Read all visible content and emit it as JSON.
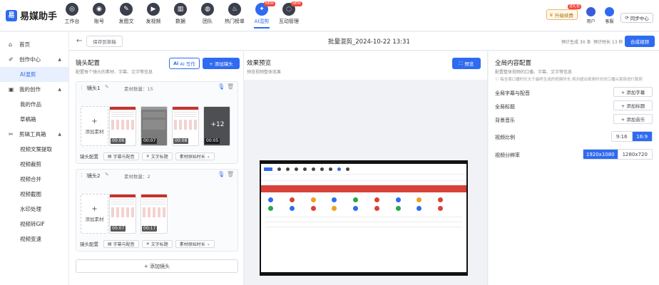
{
  "app": {
    "logo_letter": "易",
    "name": "易媒助手"
  },
  "nav": [
    {
      "label": "工作台",
      "icon": "workbench-icon",
      "glyph": "◎",
      "new": false
    },
    {
      "label": "账号",
      "icon": "account-icon",
      "glyph": "◉",
      "new": false
    },
    {
      "label": "发图文",
      "icon": "post-article-icon",
      "glyph": "✎",
      "new": false
    },
    {
      "label": "发视频",
      "icon": "post-video-icon",
      "glyph": "▶",
      "new": false
    },
    {
      "label": "数据",
      "icon": "data-icon",
      "glyph": "▥",
      "new": false
    },
    {
      "label": "团队",
      "icon": "team-icon",
      "glyph": "◍",
      "new": false
    },
    {
      "label": "热门榜单",
      "icon": "hot-list-icon",
      "glyph": "♨",
      "new": false
    },
    {
      "label": "AI混剪",
      "icon": "ai-mix-icon",
      "glyph": "✦",
      "new": true
    },
    {
      "label": "互动管理",
      "icon": "interaction-icon",
      "glyph": "◌",
      "new": true
    }
  ],
  "new_badge": "NEW",
  "top_right": {
    "upgrade_label": "升级续费",
    "upgrade_tag": "送礼包",
    "user_label": "用户",
    "service_label": "客服",
    "sync_label": "同步中心"
  },
  "sidebar": {
    "items": [
      {
        "label": "首页",
        "type": "top",
        "icon": "home-icon",
        "glyph": "⌂"
      },
      {
        "label": "创作中心",
        "type": "group",
        "icon": "create-center-icon",
        "glyph": "✐"
      },
      {
        "label": "AI混剪",
        "type": "sub",
        "active": true
      },
      {
        "label": "我的创作",
        "type": "group",
        "icon": "my-creation-icon",
        "glyph": "▣"
      },
      {
        "label": "我的作品",
        "type": "sub"
      },
      {
        "label": "草稿箱",
        "type": "sub"
      },
      {
        "label": "剪辑工具箱",
        "type": "group",
        "icon": "toolbox-icon",
        "glyph": "✂"
      },
      {
        "label": "视频文案提取",
        "type": "sub"
      },
      {
        "label": "视频裁剪",
        "type": "sub"
      },
      {
        "label": "视频合并",
        "type": "sub"
      },
      {
        "label": "视频截图",
        "type": "sub"
      },
      {
        "label": "水印处理",
        "type": "sub"
      },
      {
        "label": "视频转GIF",
        "type": "sub"
      },
      {
        "label": "视频变速",
        "type": "sub"
      }
    ]
  },
  "header": {
    "save_draft": "保存到草稿",
    "title": "批量混剪_2024-10-22 13:31",
    "est_gen": "预计生成 30 条",
    "est_time": "预计时长 13 秒",
    "compose_btn": "合成视频"
  },
  "lens": {
    "title": "镜头配置",
    "subtitle": "配置每个镜头的素材、字幕、文字等信息",
    "ai_write": "AI 写作",
    "add_lens": "+ 添加镜头",
    "add_material": "添加素材",
    "opt_label": "镜头配置",
    "opt_subtitle": "字幕与配音",
    "opt_text": "文字标题",
    "opt_duration": "素材原始时长",
    "cards": [
      {
        "name": "镜头1",
        "count": "素材数量：15",
        "thumbs": [
          {
            "style": "light",
            "dur": "00:06"
          },
          {
            "style": "gray",
            "dur": "00:07"
          },
          {
            "style": "light",
            "dur": "00:08"
          },
          {
            "style": "dark",
            "dur": "00:05",
            "more": "+12"
          }
        ]
      },
      {
        "name": "镜头2",
        "count": "素材数量：2",
        "thumbs": [
          {
            "style": "light",
            "dur": "00:07"
          },
          {
            "style": "light",
            "dur": "00:17"
          }
        ]
      }
    ],
    "add_lens_bottom": "+ 添加镜头"
  },
  "preview": {
    "title": "效果预览",
    "subtitle": "预览视频整体效果",
    "btn": "预览"
  },
  "global": {
    "title": "全局内容配置",
    "subtitle": "配置整体视频的口播、字幕、文字等信息",
    "notice": "ⓘ 每全局口播时长大于最终生成的视频时长,将对超出视频时长的口播从尾部进行裁剪",
    "rows": [
      {
        "label": "全局字幕与配音",
        "btn": "+ 添加字幕"
      },
      {
        "label": "全局标题",
        "btn": "+ 添加标题"
      },
      {
        "label": "背景音乐",
        "btn": "+ 添加音乐"
      }
    ],
    "ratio_label": "视频比例",
    "ratio_options": [
      "9:16",
      "16:9"
    ],
    "ratio_selected": "16:9",
    "resolution_label": "视频分辨率",
    "resolution_options": [
      "1920x1080",
      "1280x720"
    ],
    "resolution_selected": "1920x1080"
  },
  "colors": {
    "accent": "#2f6bf0",
    "danger": "#f5453d",
    "banner": "#d8413a"
  }
}
